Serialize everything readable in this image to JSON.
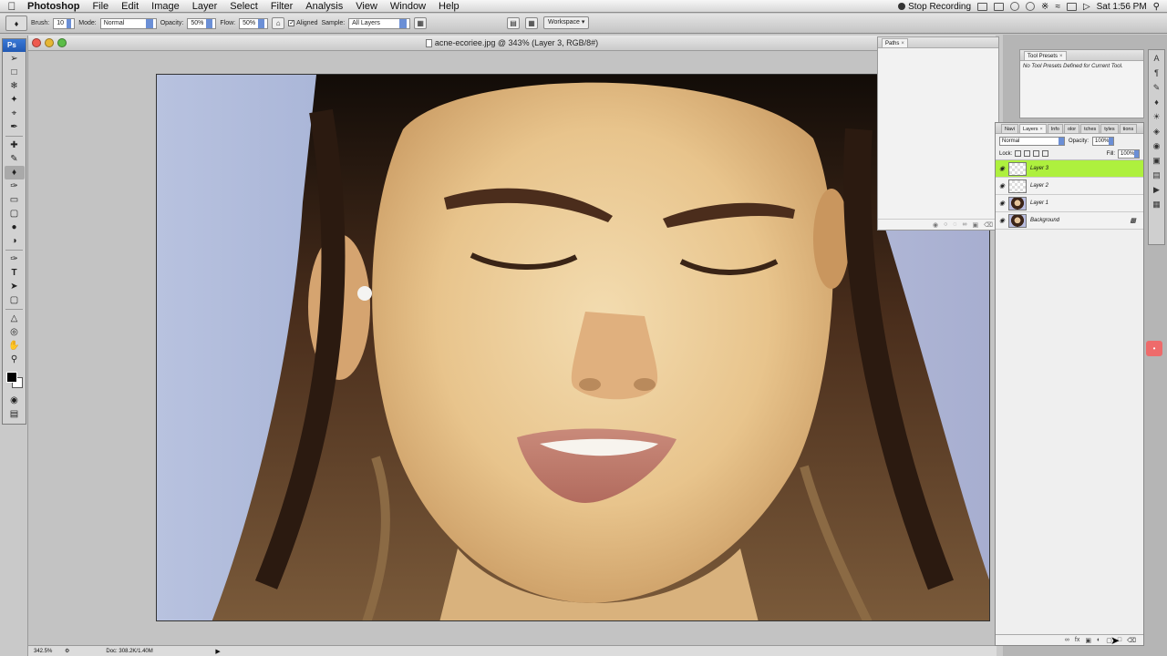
{
  "menubar": {
    "app": "Photoshop",
    "items": [
      "File",
      "Edit",
      "Image",
      "Layer",
      "Select",
      "Filter",
      "Analysis",
      "View",
      "Window",
      "Help"
    ],
    "stop_recording": "Stop Recording",
    "clock": "Sat 1:56 PM"
  },
  "options": {
    "brush_label": "Brush:",
    "brush_size": "10",
    "mode_label": "Mode:",
    "mode_value": "Normal",
    "opacity_label": "Opacity:",
    "opacity_value": "50%",
    "flow_label": "Flow:",
    "flow_value": "50%",
    "aligned_label": "Aligned",
    "sample_label": "Sample:",
    "sample_value": "All Layers",
    "workspace_label": "Workspace"
  },
  "tools_panel": {
    "badge": "Ps"
  },
  "document": {
    "title": "acne-ecoriee.jpg @ 343% (Layer 3, RGB/8#)",
    "status_zoom": "342.5%",
    "status_doc": "Doc: 308.2K/1.40M"
  },
  "paths_panel": {
    "tab": "Paths"
  },
  "presets_panel": {
    "tab": "Tool Presets",
    "empty_text": "No Tool Presets Defined for Current Tool."
  },
  "layers_panel": {
    "tabs": [
      "Navi",
      "Layers",
      "Info",
      "olor",
      "tches",
      "tyles",
      "tions"
    ],
    "blend_mode": "Normal",
    "opacity_label": "Opacity:",
    "opacity_value": "100%",
    "lock_label": "Lock:",
    "fill_label": "Fill:",
    "fill_value": "100%",
    "layers": [
      {
        "name": "Layer 3",
        "selected": true
      },
      {
        "name": "Layer 2",
        "selected": false
      },
      {
        "name": "Layer 1",
        "selected": false
      },
      {
        "name": "Background",
        "selected": false
      }
    ]
  },
  "icons": {
    "apple": "apple-icon",
    "eye": "eye-icon",
    "lock": "lock-icon"
  },
  "colors": {
    "selected_layer": "#aef03e",
    "panel_header": "#2f6fd0"
  }
}
